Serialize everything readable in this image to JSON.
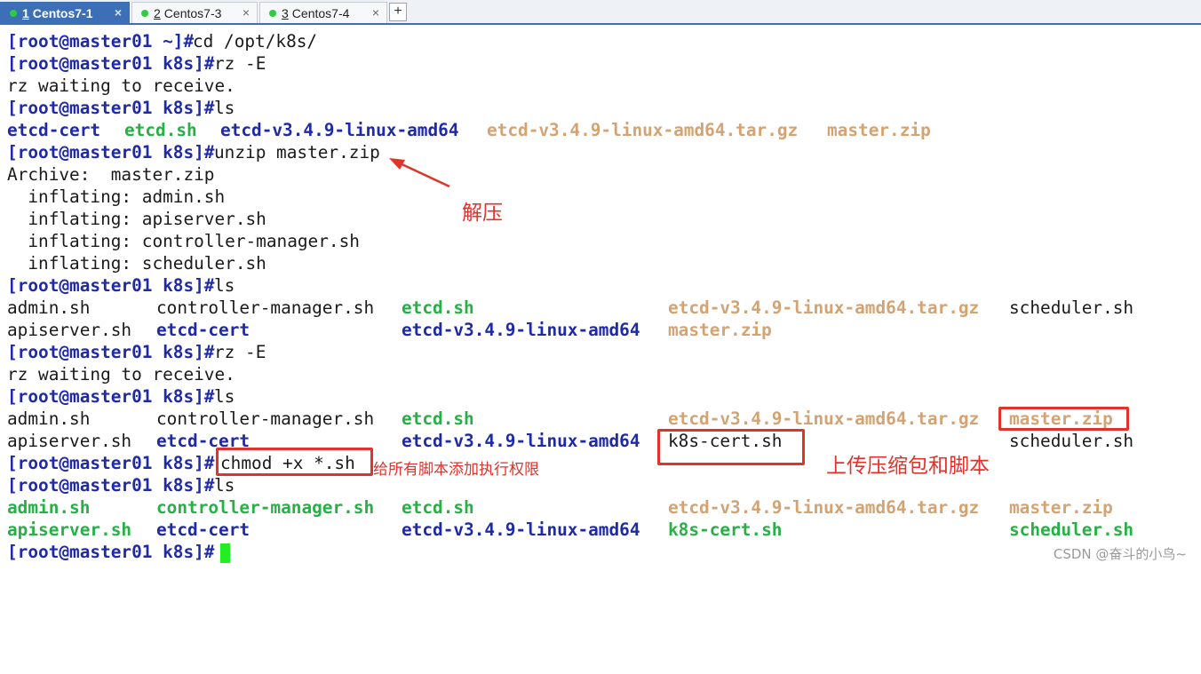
{
  "tabs": [
    {
      "num": "1",
      "label": "Centos7-1",
      "dot_color": "#2ecc40",
      "active": true
    },
    {
      "num": "2",
      "label": "Centos7-3",
      "dot_color": "#2ecc40",
      "active": false
    },
    {
      "num": "3",
      "label": "Centos7-4",
      "dot_color": "#2ecc40",
      "active": false
    }
  ],
  "tab_close": "×",
  "tab_add": "+",
  "prompt": "[root@master01 k8s]#",
  "prompt_home": "[root@master01 ~]#",
  "lines": {
    "l1_cmd": "cd /opt/k8s/",
    "l2_cmd": "rz -E",
    "l3": "rz waiting to receive.",
    "l4_cmd": "ls",
    "l5": [
      "etcd-cert",
      "etcd.sh",
      "etcd-v3.4.9-linux-amd64",
      "etcd-v3.4.9-linux-amd64.tar.gz",
      "master.zip"
    ],
    "l6_cmd": "unzip master.zip",
    "l7": "Archive:  master.zip",
    "l8": "  inflating: admin.sh",
    "l9": "  inflating: apiserver.sh",
    "l10": "  inflating: controller-manager.sh",
    "l11": "  inflating: scheduler.sh",
    "l12_cmd": "ls",
    "l13": [
      "admin.sh",
      "controller-manager.sh",
      "etcd.sh",
      "etcd-v3.4.9-linux-amd64.tar.gz",
      "scheduler.sh"
    ],
    "l14": [
      "apiserver.sh",
      "etcd-cert",
      "etcd-v3.4.9-linux-amd64",
      "master.zip"
    ],
    "l15_cmd": "rz -E",
    "l16": "rz waiting to receive.",
    "l17_cmd": "ls",
    "l18": [
      "admin.sh",
      "controller-manager.sh",
      "etcd.sh",
      "etcd-v3.4.9-linux-amd64.tar.gz",
      "master.zip"
    ],
    "l19": [
      "apiserver.sh",
      "etcd-cert",
      "etcd-v3.4.9-linux-amd64",
      "k8s-cert.sh",
      "scheduler.sh"
    ],
    "l20_cmd": "chmod +x *.sh",
    "l21_cmd": "ls",
    "l22": [
      "admin.sh",
      "controller-manager.sh",
      "etcd.sh",
      "etcd-v3.4.9-linux-amd64.tar.gz",
      "master.zip"
    ],
    "l23": [
      "apiserver.sh",
      "etcd-cert",
      "etcd-v3.4.9-linux-amd64",
      "k8s-cert.sh",
      "scheduler.sh"
    ]
  },
  "annotations": {
    "unzip": "解压",
    "chmod": "给所有脚本添加执行权限",
    "upload": "上传压缩包和脚本"
  },
  "colors": {
    "prompt": "#1f2aa8",
    "directory": "#1f2aa8",
    "executable": "#27b045",
    "archive": "#d4a373",
    "annotation": "#e0332a",
    "cursor": "#22ee22"
  },
  "watermark": "CSDN @奋斗的小鸟~"
}
